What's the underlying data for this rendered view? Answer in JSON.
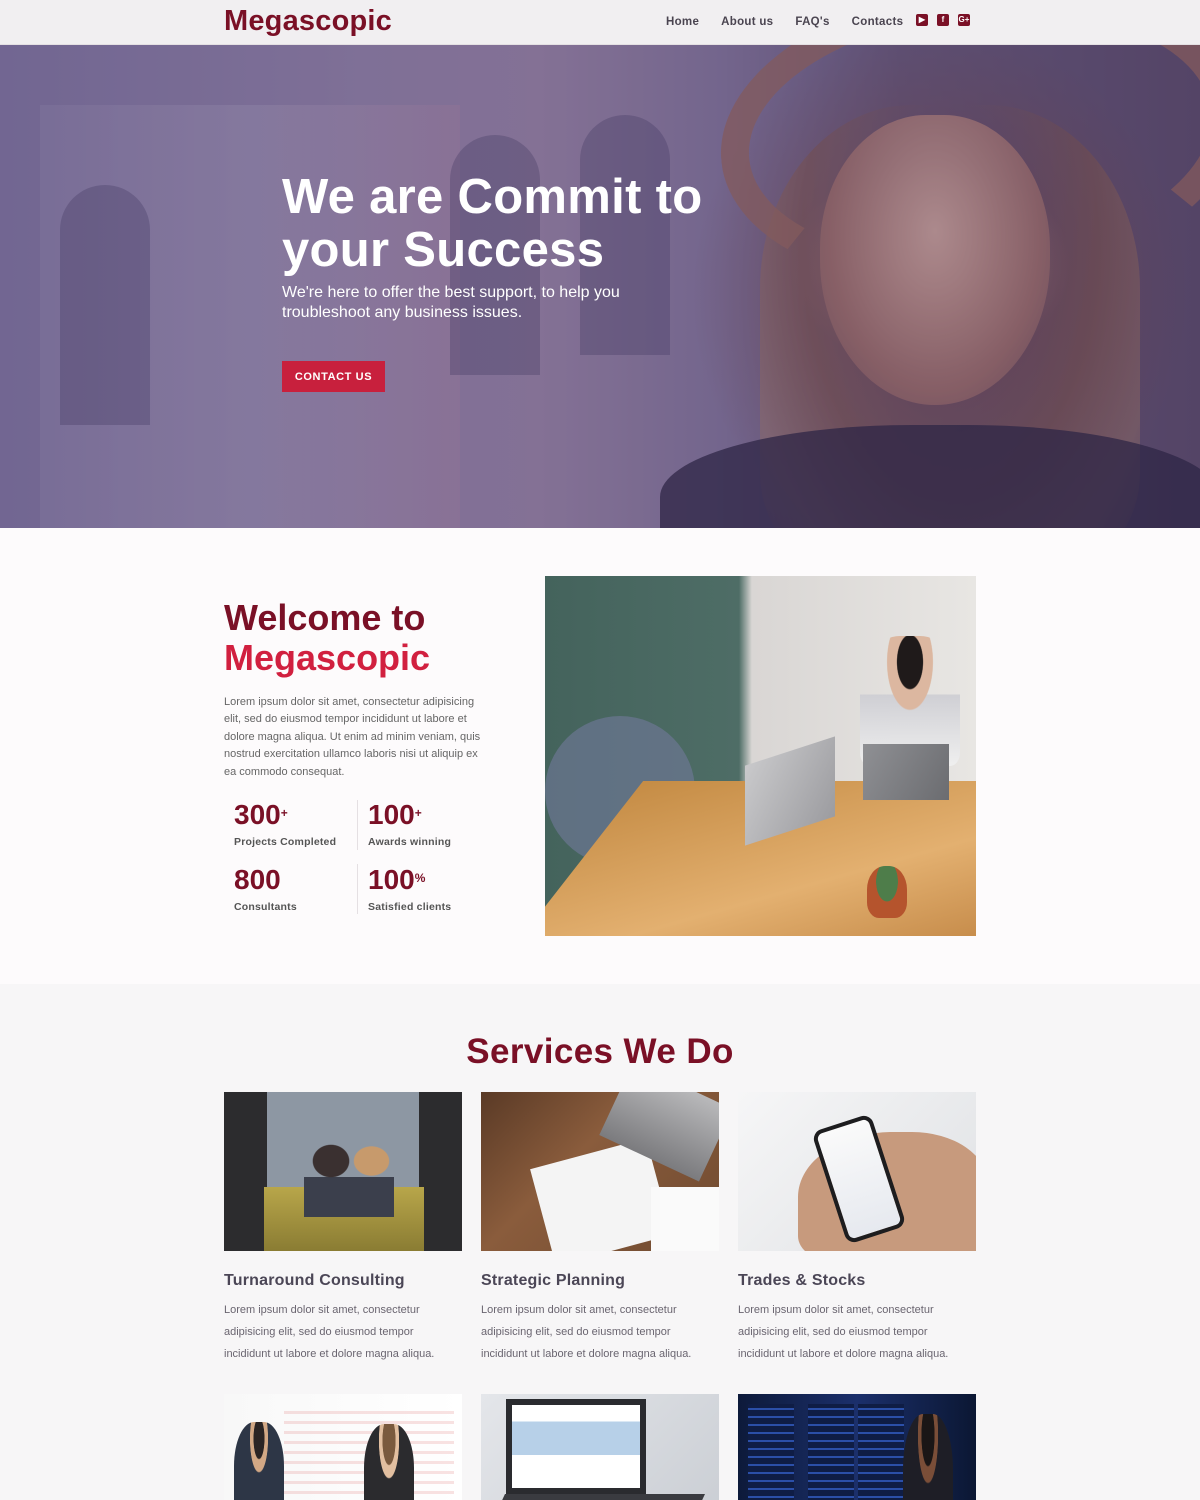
{
  "nav": {
    "brand": "Megascopic",
    "links": [
      "Home",
      "About us",
      "FAQ's",
      "Contacts"
    ],
    "social_icons": [
      "youtube-icon",
      "facebook-icon",
      "google-plus-icon"
    ],
    "social_glyphs": [
      "▶",
      "f",
      "G+"
    ]
  },
  "hero": {
    "title": "We are Commit to your Success",
    "subtitle": "We're here to offer the best support, to help you troubleshoot any business issues.",
    "cta": "CONTACT US"
  },
  "welcome": {
    "title_line1": "Welcome to",
    "title_line2": "Megascopic",
    "body": "Lorem ipsum dolor sit amet, consectetur adipisicing elit, sed do eiusmod tempor incididunt ut labore et dolore magna aliqua. Ut enim ad minim veniam, quis nostrud exercitation ullamco laboris nisi ut aliquip ex ea commodo consequat.",
    "stats": [
      {
        "value": "300",
        "suffix": "+",
        "label": "Projects Completed"
      },
      {
        "value": "100",
        "suffix": "+",
        "label": "Awards winning"
      },
      {
        "value": "800",
        "suffix": "",
        "label": "Consultants"
      },
      {
        "value": "100",
        "suffix": "%",
        "label": "Satisfied clients"
      }
    ]
  },
  "services": {
    "title": "Services We Do",
    "items": [
      {
        "title": "Turnaround Consulting",
        "text": "Lorem ipsum dolor sit amet, consectetur adipisicing elit, sed do eiusmod tempor incididunt ut labore et dolore magna aliqua."
      },
      {
        "title": "Strategic Planning",
        "text": "Lorem ipsum dolor sit amet, consectetur adipisicing elit, sed do eiusmod tempor incididunt ut labore et dolore magna aliqua."
      },
      {
        "title": "Trades & Stocks",
        "text": "Lorem ipsum dolor sit amet, consectetur adipisicing elit, sed do eiusmod tempor incididunt ut labore et dolore magna aliqua."
      }
    ]
  },
  "colors": {
    "brand_dark": "#7a1026",
    "brand_red": "#d1203f",
    "button": "#c8203d"
  }
}
